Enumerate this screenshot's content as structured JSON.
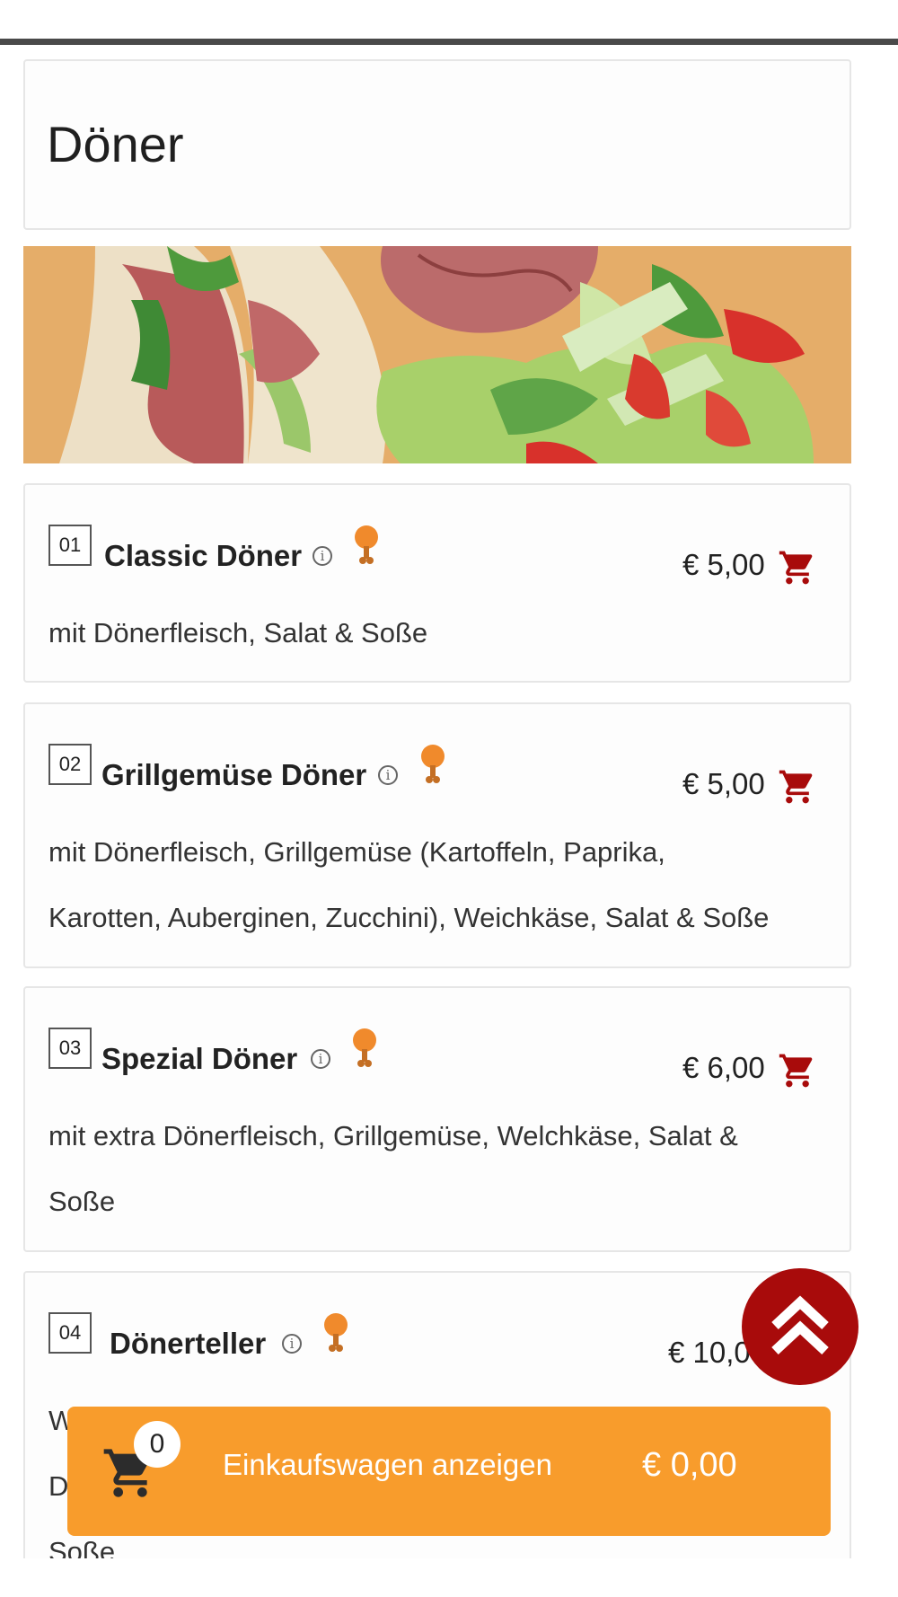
{
  "category": {
    "title": "Döner"
  },
  "items": [
    {
      "number": "01",
      "name": "Classic Döner",
      "price": "€ 5,00",
      "description_lines": [
        "mit Dönerfleisch, Salat & Soße"
      ]
    },
    {
      "number": "02",
      "name": "Grillgemüse Döner",
      "price": "€ 5,00",
      "description_lines": [
        "mit Dönerfleisch, Grillgemüse (Kartoffeln, Paprika,",
        "Karotten, Auberginen, Zucchini), Weichkäse, Salat & Soße"
      ]
    },
    {
      "number": "03",
      "name": "Spezial Döner",
      "price": "€ 6,00",
      "description_lines": [
        "mit extra Dönerfleisch, Grillgemüse, Welchkäse, Salat &",
        "Soße"
      ]
    },
    {
      "number": "04",
      "name": "Dönerteller",
      "price": "€ 10,0",
      "description_lines": [
        "W",
        "D",
        "Soße"
      ]
    }
  ],
  "cart": {
    "count": "0",
    "label": "Einkaufswagen anzeigen",
    "total": "€ 0,00"
  },
  "colors": {
    "accent_red": "#a80b0b",
    "cart_orange": "#f89c2c",
    "tag_orange": "#f08a2c"
  },
  "icons": {
    "info": "info-icon",
    "tag": "chicken-leg-icon",
    "cart": "shopping-cart-icon",
    "scroll": "double-chevron-up-icon"
  }
}
